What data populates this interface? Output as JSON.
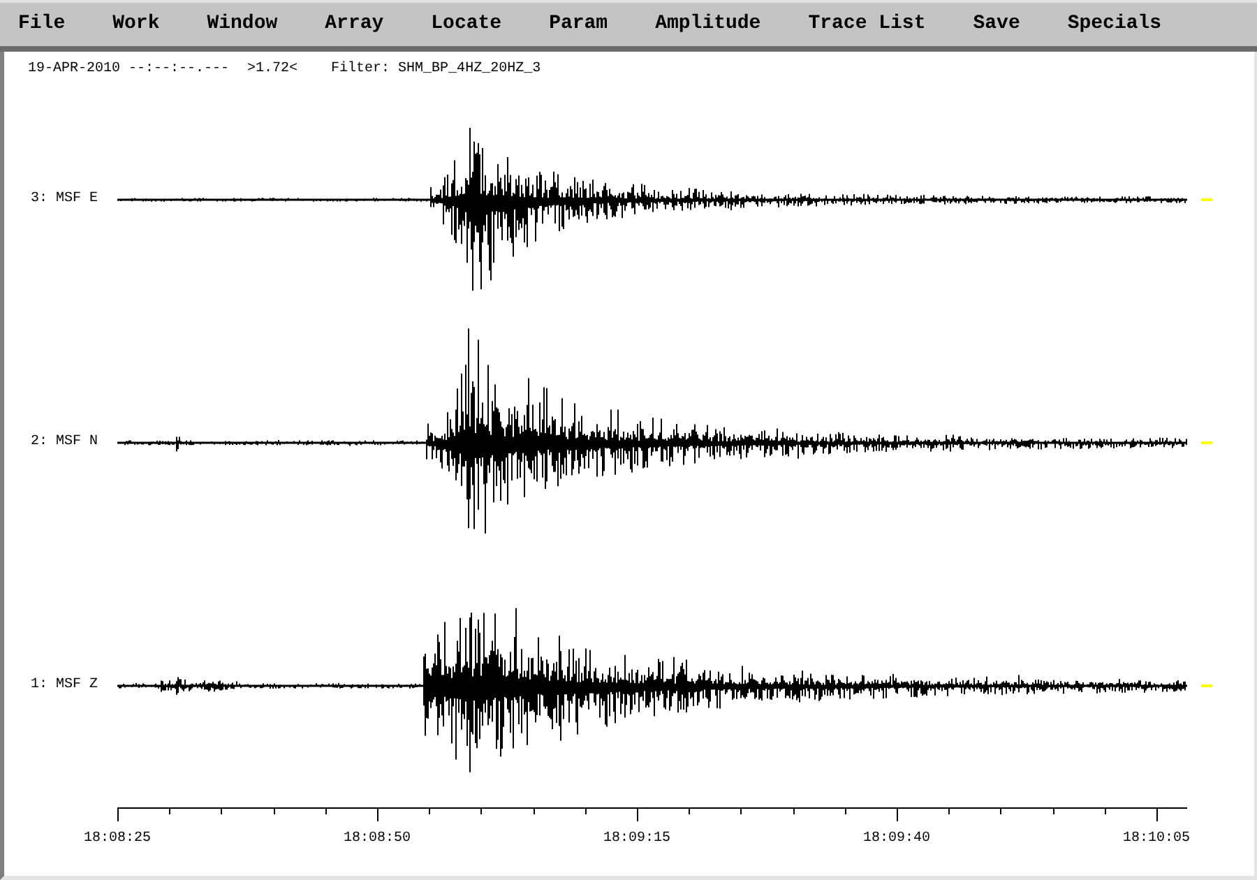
{
  "menu_bar": {
    "items": [
      "File",
      "Work",
      "Window",
      "Array",
      "Locate",
      "Param",
      "Amplitude",
      "Trace List",
      "Save",
      "Specials"
    ]
  },
  "header": {
    "time": "19-APR-2010 --:--:--.---",
    "scale": ">1.72<",
    "filter": "Filter: SHM_BP_4HZ_20HZ_3"
  },
  "traces": [
    {
      "label": "3: MSF E"
    },
    {
      "label": "2: MSF N"
    },
    {
      "label": "1: MSF Z"
    }
  ],
  "time_axis": {
    "labels": [
      "18:08:25",
      "18:08:50",
      "18:09:15",
      "18:09:40",
      "18:10:05"
    ]
  }
}
